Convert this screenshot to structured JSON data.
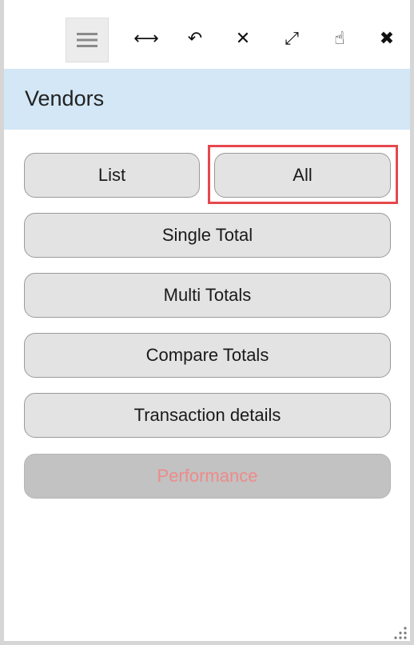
{
  "toolbar": {
    "icons": {
      "menu": "menu-icon",
      "width": "arrows-horizontal-icon",
      "undo": "undo-arrow-icon",
      "collapse": "collapse-arrows-icon",
      "expand": "expand-diagonal-icon",
      "pointer": "hand-pointer-icon",
      "close": "close-icon"
    },
    "glyphs": {
      "menu": "≡",
      "width": "⟷",
      "undo": "↶",
      "collapse": "✕",
      "expand": "⤢",
      "pointer": "☝",
      "close": "✖"
    }
  },
  "header": {
    "title": "Vendors"
  },
  "buttons": {
    "list": "List",
    "all": "All",
    "single_total": "Single Total",
    "multi_totals": "Multi Totals",
    "compare_totals": "Compare Totals",
    "transaction_details": "Transaction details",
    "performance": "Performance"
  },
  "colors": {
    "header_bg": "#d3e7f6",
    "button_bg": "#e3e3e3",
    "disabled_bg": "#c2c2c2",
    "disabled_text": "#ee8a8a",
    "highlight": "#e5484d"
  }
}
